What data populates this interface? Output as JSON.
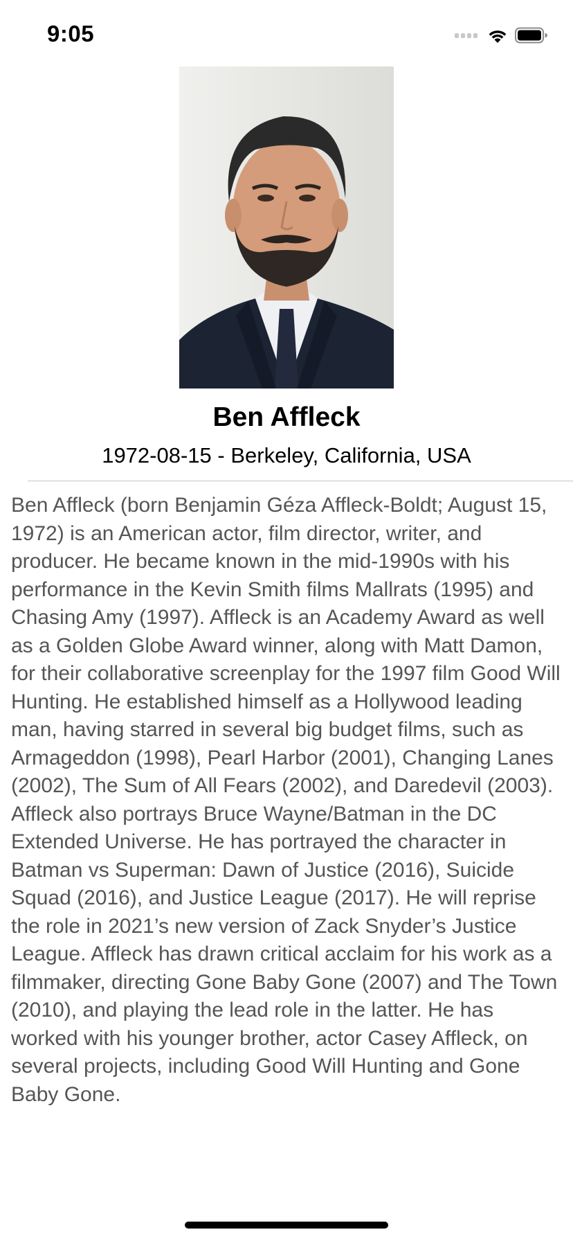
{
  "status_bar": {
    "time": "9:05",
    "icons": [
      "cellular-signal-icon",
      "wifi-icon",
      "battery-icon"
    ]
  },
  "person": {
    "name": "Ben Affleck",
    "subtitle": "1972-08-15 - Berkeley, California, USA",
    "photo_icon": "portrait-photo",
    "biography": "Ben Affleck (born Benjamin Géza Affleck-Boldt; August 15, 1972) is an American actor, film director, writer, and producer. He became known in the mid-1990s with his performance in the Kevin Smith films Mallrats (1995) and Chasing Amy (1997). Affleck is an Academy Award as well as a Golden Globe Award winner, along with Matt Damon, for their collaborative screenplay for the 1997 film Good Will Hunting. He established himself as a Hollywood leading man, having starred in several big budget films, such as Armageddon (1998), Pearl Harbor (2001), Changing Lanes (2002), The Sum of All Fears (2002), and Daredevil (2003). Affleck also portrays Bruce Wayne/Batman in the DC Extended Universe. He has portrayed the character in Batman vs Superman: Dawn of Justice (2016), Suicide Squad (2016), and Justice League (2017). He will reprise the role in 2021’s new version of Zack Snyder’s Justice League. Affleck has drawn critical acclaim for his work as a filmmaker, directing Gone Baby Gone (2007) and The Town (2010), and playing the lead role in the latter. He has worked with his younger brother, actor Casey Affleck, on several projects, including Good Will Hunting and Gone Baby Gone."
  },
  "colors": {
    "background": "#ffffff",
    "title_text": "#000000",
    "body_text": "#555555",
    "divider": "#c6c6c8",
    "home_indicator": "#000000"
  }
}
